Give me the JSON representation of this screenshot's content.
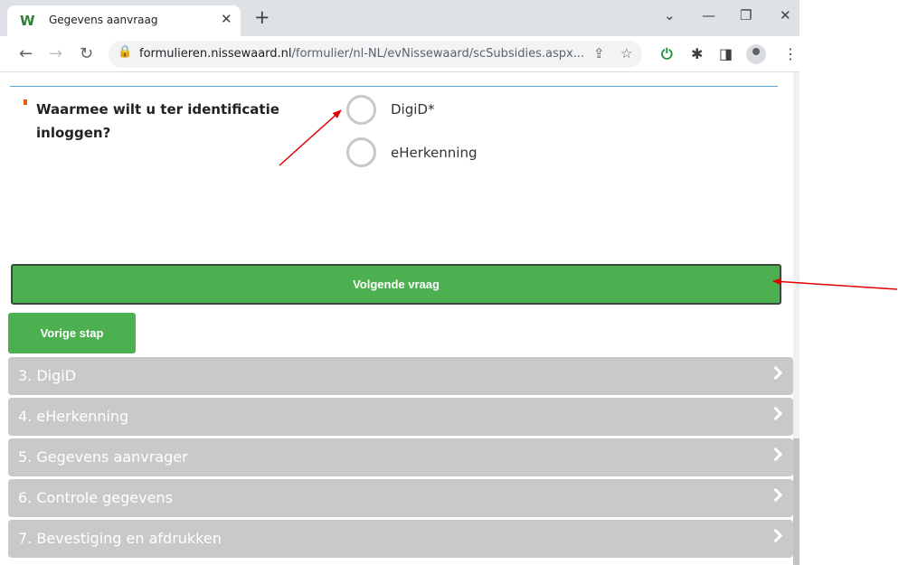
{
  "browser": {
    "tab_title": "Gegevens aanvraag",
    "url_host": "formulieren.nissewaard.nl",
    "url_path": "/formulier/nl-NL/evNissewaard/scSubsidies.aspx..."
  },
  "form": {
    "question": "Waarmee wilt u ter identificatie inloggen?",
    "options": [
      {
        "label": "DigiD*",
        "selected": false
      },
      {
        "label": "eHerkenning",
        "selected": false
      }
    ],
    "next_button": "Volgende vraag",
    "prev_button": "Vorige stap"
  },
  "steps": [
    {
      "label": "3. DigiD"
    },
    {
      "label": "4. eHerkenning"
    },
    {
      "label": "5. Gegevens aanvrager"
    },
    {
      "label": "6. Controle gegevens"
    },
    {
      "label": "7. Bevestiging en afdrukken"
    }
  ],
  "colors": {
    "accent_green": "#4caf50",
    "step_gray": "#c9c9c9",
    "annotation_red": "#e00000",
    "required_marker": "#e35b0e"
  },
  "icons": {
    "favicon": "nissewaard-w-logo",
    "nav": [
      "back-arrow-icon",
      "forward-arrow-icon",
      "reload-icon"
    ],
    "toolbar": [
      "share-icon",
      "star-icon",
      "power-extension-icon",
      "puzzle-extensions-icon",
      "side-panel-icon",
      "profile-avatar-icon",
      "menu-kebab-icon"
    ]
  }
}
